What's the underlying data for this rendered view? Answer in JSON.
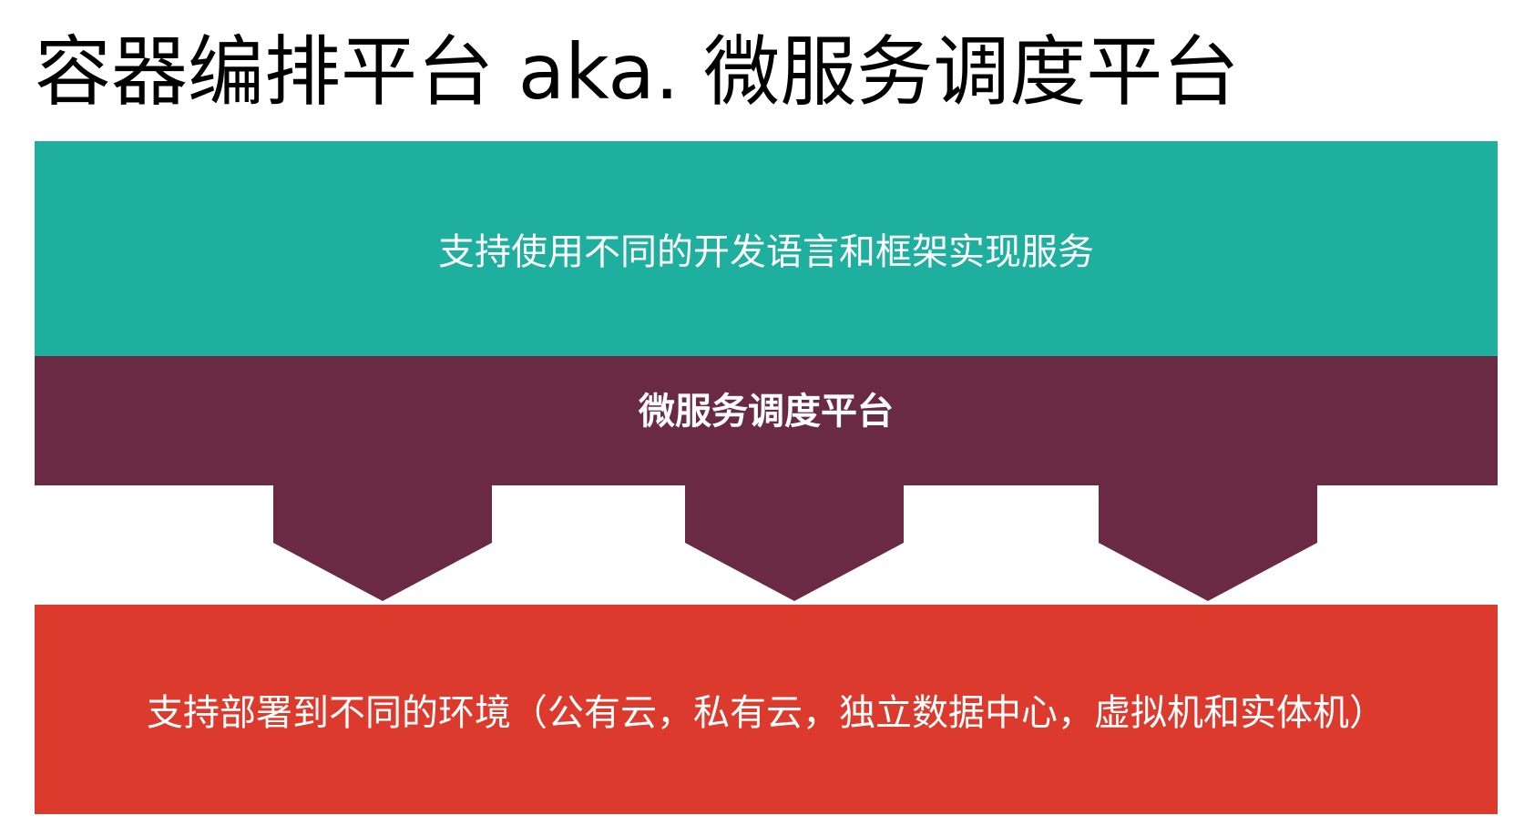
{
  "title": "容器编排平台 aka. 微服务调度平台",
  "layers": {
    "top": {
      "text": "支持使用不同的开发语言和框架实现服务",
      "color": "#1eaf9e"
    },
    "middle": {
      "text": "微服务调度平台",
      "color": "#6a2a43"
    },
    "bottom": {
      "text": "支持部署到不同的环境（公有云，私有云，独立数据中心，虚拟机和实体机）",
      "color": "#dc3a2c"
    }
  },
  "arrow_count": 3
}
